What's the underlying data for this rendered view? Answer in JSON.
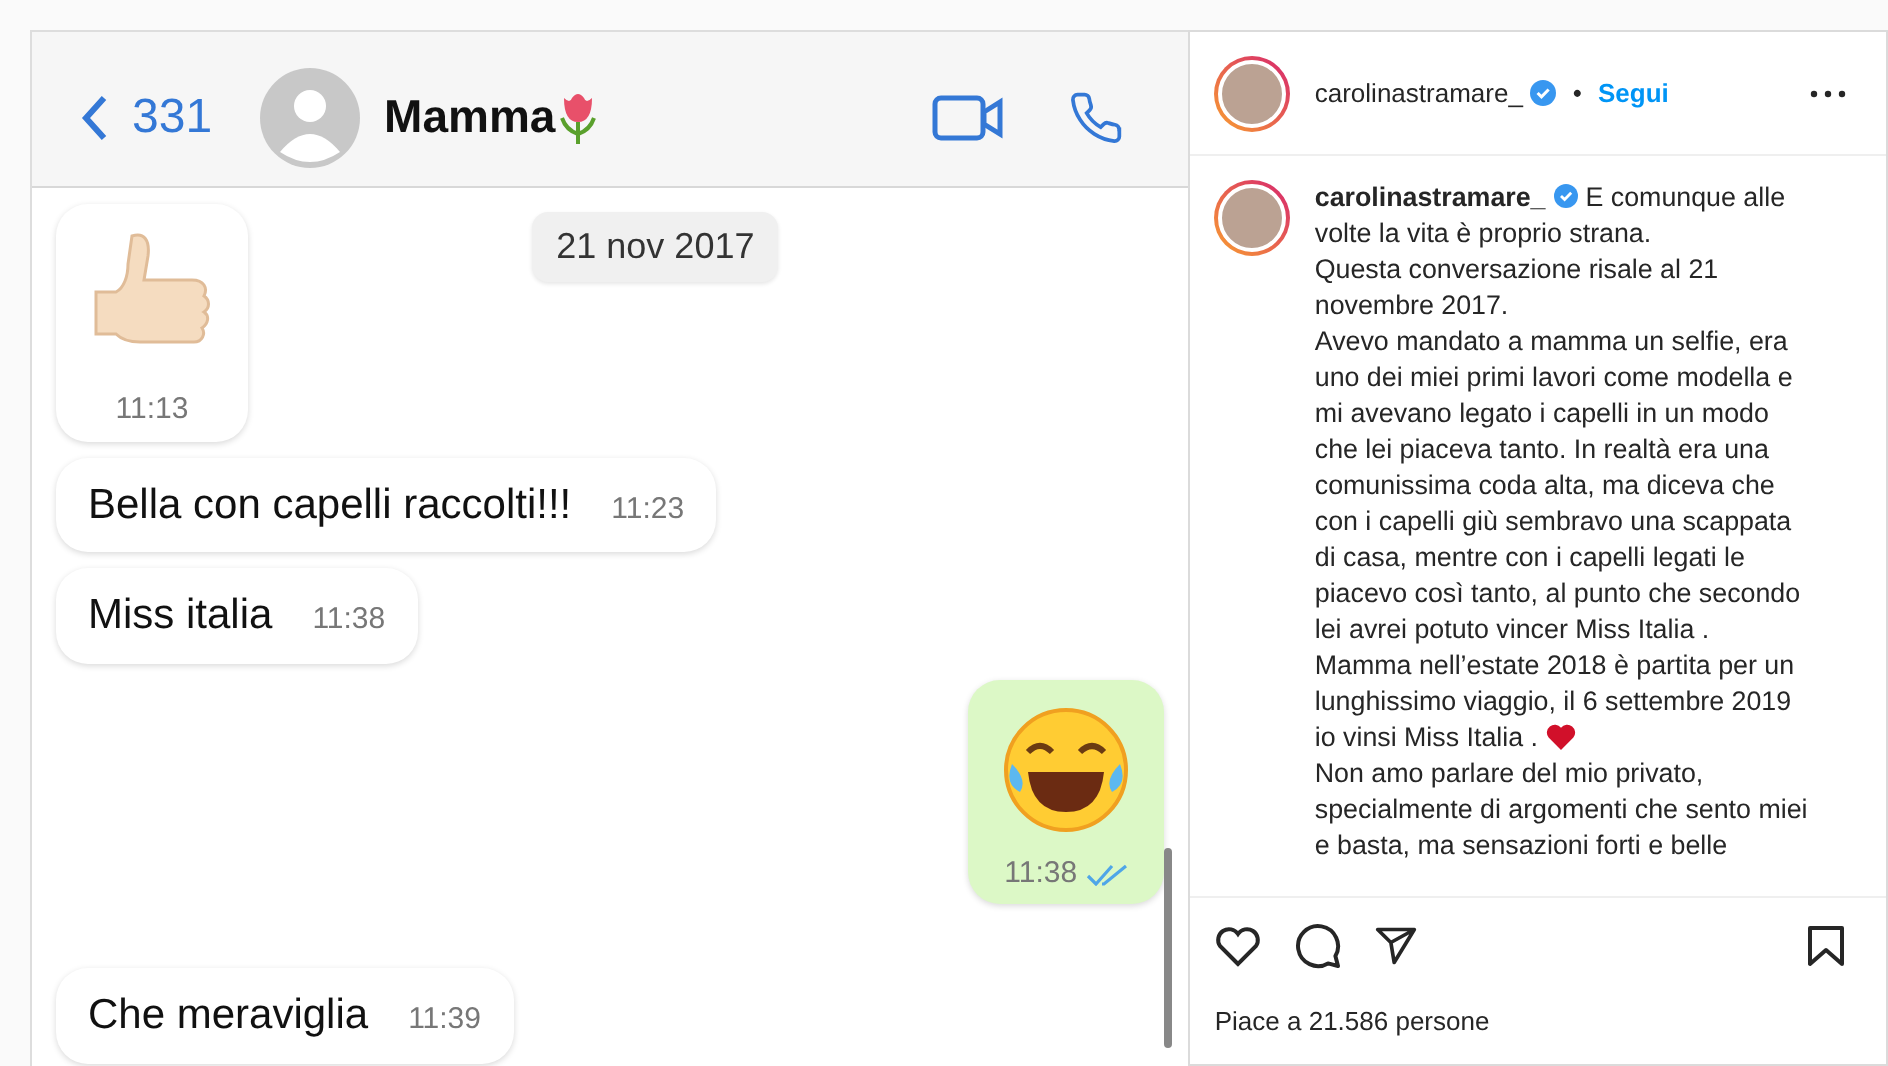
{
  "chat": {
    "back_count": "331",
    "contact_name": "Mamma",
    "date_chip": "21 nov 2017",
    "messages": [
      {
        "kind": "thumbs",
        "outgoing": false,
        "time": "11:13"
      },
      {
        "kind": "text",
        "outgoing": false,
        "text": "Bella con capelli raccolti!!!",
        "time": "11:23"
      },
      {
        "kind": "text",
        "outgoing": false,
        "text": "Miss italia",
        "time": "11:38"
      },
      {
        "kind": "laugh",
        "outgoing": true,
        "time": "11:38",
        "read": true
      },
      {
        "kind": "text",
        "outgoing": false,
        "text": "Che meraviglia",
        "time": "11:39"
      }
    ]
  },
  "post": {
    "username": "carolinastramare_",
    "verified": true,
    "separator": "•",
    "follow": "Segui",
    "caption_username": "carolinastramare_",
    "caption_verified": true,
    "caption": [
      {
        "text": "E comunque alle volte la vita è proprio strana."
      },
      {
        "text": "Questa conversazione risale al 21 novembre 2017."
      },
      {
        "text": "Avevo mandato a mamma un selfie, era uno dei miei primi lavori come modella e mi avevano legato i capelli in un modo che lei piaceva tanto. In realtà era una comunissima coda alta, ma diceva che con i capelli giù sembravo una scappata di casa, mentre con i capelli legati le piacevo così tanto, al punto che secondo lei avrei potuto vincer Miss Italia ."
      },
      {
        "text": "Mamma nell’estate 2018 è partita per un lunghissimo viaggio, il 6 settembre 2019 io vinsi Miss Italia .",
        "heart": true
      },
      {
        "text": "Non amo parlare del mio privato, specialmente di argomenti che sento miei e basta, ma sensazioni forti e belle"
      }
    ],
    "liked": false,
    "saved": false,
    "likes": "Piace a 21.586 persone"
  }
}
